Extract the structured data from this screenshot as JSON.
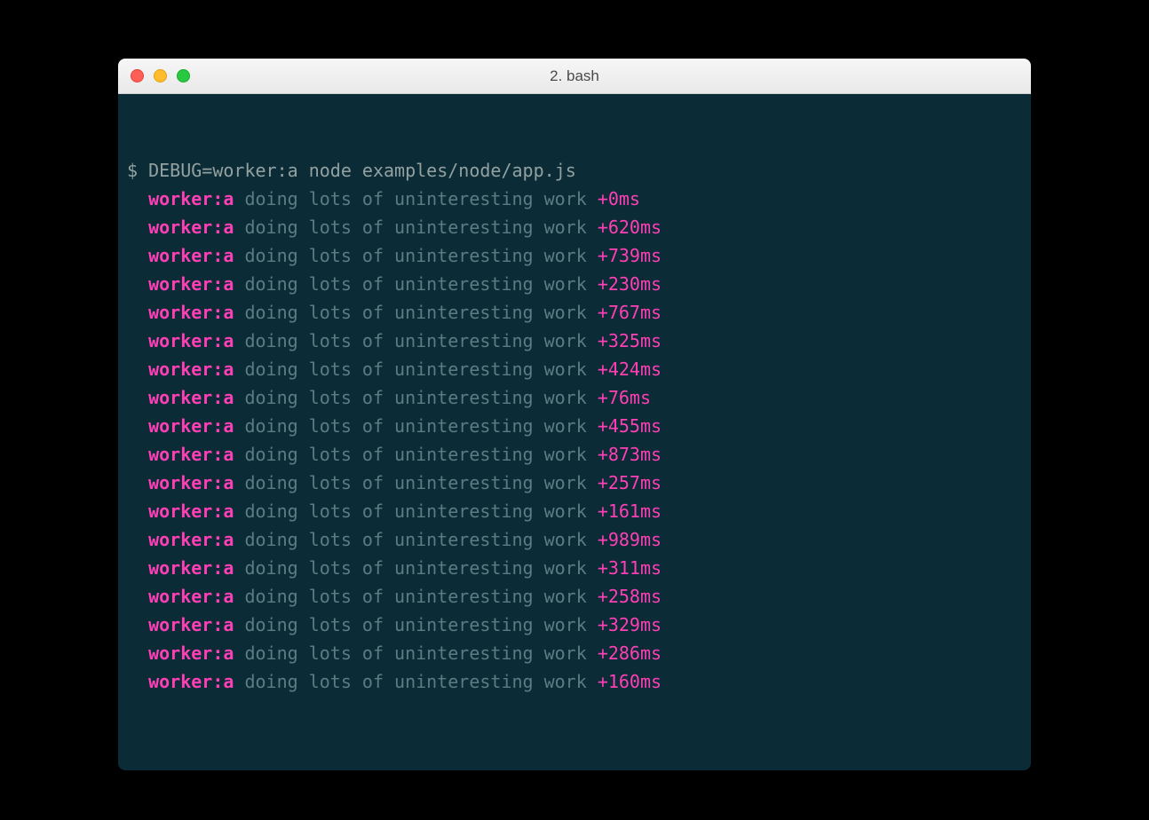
{
  "window": {
    "title": "2. bash"
  },
  "terminal": {
    "prompt": "$",
    "command": "DEBUG=worker:a node examples/node/app.js",
    "lines": [
      {
        "tag": "worker:a",
        "msg": "doing lots of uninteresting work",
        "time": "+0ms"
      },
      {
        "tag": "worker:a",
        "msg": "doing lots of uninteresting work",
        "time": "+620ms"
      },
      {
        "tag": "worker:a",
        "msg": "doing lots of uninteresting work",
        "time": "+739ms"
      },
      {
        "tag": "worker:a",
        "msg": "doing lots of uninteresting work",
        "time": "+230ms"
      },
      {
        "tag": "worker:a",
        "msg": "doing lots of uninteresting work",
        "time": "+767ms"
      },
      {
        "tag": "worker:a",
        "msg": "doing lots of uninteresting work",
        "time": "+325ms"
      },
      {
        "tag": "worker:a",
        "msg": "doing lots of uninteresting work",
        "time": "+424ms"
      },
      {
        "tag": "worker:a",
        "msg": "doing lots of uninteresting work",
        "time": "+76ms"
      },
      {
        "tag": "worker:a",
        "msg": "doing lots of uninteresting work",
        "time": "+455ms"
      },
      {
        "tag": "worker:a",
        "msg": "doing lots of uninteresting work",
        "time": "+873ms"
      },
      {
        "tag": "worker:a",
        "msg": "doing lots of uninteresting work",
        "time": "+257ms"
      },
      {
        "tag": "worker:a",
        "msg": "doing lots of uninteresting work",
        "time": "+161ms"
      },
      {
        "tag": "worker:a",
        "msg": "doing lots of uninteresting work",
        "time": "+989ms"
      },
      {
        "tag": "worker:a",
        "msg": "doing lots of uninteresting work",
        "time": "+311ms"
      },
      {
        "tag": "worker:a",
        "msg": "doing lots of uninteresting work",
        "time": "+258ms"
      },
      {
        "tag": "worker:a",
        "msg": "doing lots of uninteresting work",
        "time": "+329ms"
      },
      {
        "tag": "worker:a",
        "msg": "doing lots of uninteresting work",
        "time": "+286ms"
      },
      {
        "tag": "worker:a",
        "msg": "doing lots of uninteresting work",
        "time": "+160ms"
      }
    ]
  }
}
